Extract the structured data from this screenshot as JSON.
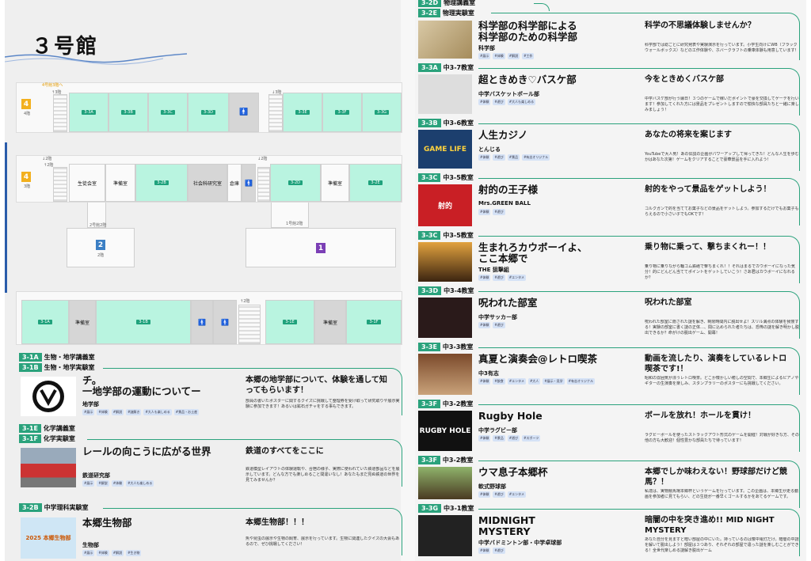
{
  "title": "３号館",
  "floors": {
    "f4_top": {
      "num": "4",
      "num_small": "4階",
      "up_note": "4号館3階へ",
      "up_note2": "↑3階",
      "stair_note": "↓3階",
      "rooms": [
        "3-3A",
        "3-3B",
        "3-3C",
        "3-3D",
        "3-3E",
        "3-3F",
        "3-3G"
      ]
    },
    "f3": {
      "num": "4",
      "num_small": "3階",
      "stair_note": "↓2階",
      "stair_note2": "↓2階",
      "stair_up": "↑2階",
      "rooms": [
        "生徒会室",
        "準備室",
        "3-2B",
        "社会科研究室",
        "倉庫",
        "3-2D",
        "準備室",
        "3-2E"
      ],
      "link_left": "2号館2階",
      "link_right": "1号館2階",
      "num2": "2",
      "num2_small": "2階",
      "num1": "1"
    },
    "f2": {
      "stair_note": "↑2階",
      "rooms": [
        "3-1A",
        "準備室",
        "3-1B",
        "3-1E",
        "準備室",
        "3-1F"
      ]
    }
  },
  "left_entries": [
    {
      "rooms": [
        {
          "code": "3-1A",
          "name": "生物・地学講義室"
        },
        {
          "code": "3-1B",
          "name": "生物・地学実験室"
        }
      ],
      "title": "チ。\n一地学部の運動についてー",
      "club": "地学部",
      "tags": [
        "#展示",
        "#体験",
        "#解説",
        "#謎解き",
        "#大人も楽しめる",
        "#景品・お土産"
      ],
      "headline": "本郷の地学部について、体験を通して知ってもらいます！",
      "desc": "部員の書いたポスターに関するクイズに挑戦して整理券を受け取って研究取りや展示実験に参加できます！あるいは鉱石ガチャをする事もできます。"
    },
    {
      "rooms": [
        {
          "code": "3-1E",
          "name": "化学講義室"
        },
        {
          "code": "3-1F",
          "name": "化学実験室"
        }
      ],
      "title": "レールの向こうに広がる世界",
      "club": "鉄道研究部",
      "tags": [
        "#展示",
        "#解説",
        "#体験",
        "#大人も楽しめる"
      ],
      "headline": "鉄道のすべてをここに",
      "desc": "鉄道模型レイアウトの体験運転や、合宿の様子、実際に使われていた鉄道部品などを展示しています。どんな方でも楽しめること間違いなし！あなたもまだ見ぬ鉄道の世界を見てみませんか？"
    },
    {
      "rooms": [
        {
          "code": "3-2B",
          "name": "中学理科実験室"
        }
      ],
      "title": "本郷生物部",
      "club": "生物部",
      "tags": [
        "#展示",
        "#体験",
        "#解説",
        "#生き物"
      ],
      "headline": "本郷生物部！！！",
      "desc": "魚や昆虫の展示や生物の飼育、展示を行っています。生物に関連したクイズの大会もあるので、ぜひ挑戦してください！",
      "thumb_text": "2025 本郷生物部"
    }
  ],
  "right_top_rooms": [
    {
      "code": "3-2D",
      "name": "物理講義室"
    },
    {
      "code": "3-2E",
      "name": "物理実験室"
    }
  ],
  "right_entries": [
    {
      "room": null,
      "title": "科学部の科学部による\n科学部のための科学部",
      "club": "科学部",
      "tags": [
        "#展示",
        "#体験",
        "#解説",
        "#工作"
      ],
      "headline": "科学の不思議体験しませんか？",
      "desc": "科学部では総ごとに研究発表や実験演示を行っています。小学生向けにWB（ブラックウォールボックス）などの工作体験や、ホバークラフトの乗車体験も用意しています！"
    },
    {
      "room": {
        "code": "3-3A",
        "name": "中3-7教室"
      },
      "title": "超ときめき♡バスケ部",
      "club": "中学バスケットボール部",
      "tags": [
        "#体験",
        "#遊び",
        "#大人も楽しめる"
      ],
      "headline": "今をときめくバスケ部",
      "desc": "中学バスケ部が行う縁日！３つのゲームで稼いだポイントで豪を交換してゲーテを行います！参加してくれた方には景品をプレゼントしますので愉快な部員たちと一緒に楽しみましょう！"
    },
    {
      "room": {
        "code": "3-3B",
        "name": "中3-6教室"
      },
      "title": "人生カジノ",
      "club": "とんじる",
      "tags": [
        "#体験",
        "#遊び",
        "#景品",
        "#有志オリジナル"
      ],
      "headline": "あなたの将来を案じます",
      "desc": "YouTubeで大人気！あの伝説の企画がパワーアップして帰ってきた！どんな人生を歩むかはあなた次第！ゲームをクリアすることで豪華景品を手に入れよう！",
      "thumb_text": "GAME LIFE"
    },
    {
      "room": {
        "code": "3-3C",
        "name": "中3-5教室"
      },
      "title": "射的の王子様",
      "club": "Mrs.GREEN BALL",
      "tags": [
        "#体験",
        "#遊び"
      ],
      "headline": "射的をやって景品をゲットしよう！",
      "desc": "コルクガンで的を当ててお菓子などの景品をゲットしよう。参加するだけでもお菓子もらえるので小さい子でもOKです！",
      "thumb_text": "射的"
    },
    {
      "room": {
        "code": "3-3C",
        "name": "中3-5教室"
      },
      "title": "生まれろカウボーイよ、\nここ本郷で",
      "club": "THE 狙撃組",
      "tags": [
        "#体験",
        "#遊び",
        "#エンタメ"
      ],
      "headline": "乗り物に乗って、撃ちまくれー！！",
      "desc": "乗り物に乗りながら輪ゴム鉄砲で撃ちまくれ！！それはまるでカウボーイになった気分！的にどんどん当ててポイントをゲットしていこう！さあ君はカウボーイになれるか？"
    },
    {
      "room": {
        "code": "3-3D",
        "name": "中3-4教室"
      },
      "title": "呪われた部室",
      "club": "中学サッカー部",
      "tags": [
        "#体験",
        "#遊び"
      ],
      "headline": "呪われた部室",
      "desc": "呪われた部室に隠された謎を解き、制限時間内に脱出せよ！スリル満点の体験を我慢する！実験の部室に書く謎の正体…、間に込められた者たちは、恐怖の謎を解き明かし脱出できるか？命がけの脱出ゲーム、開幕！"
    },
    {
      "room": {
        "code": "3-3E",
        "name": "中3-3教室"
      },
      "title": "真夏と演奏会@レトロ喫茶",
      "club": "中3有志",
      "tags": [
        "#体験",
        "#飲食",
        "#エンタメ",
        "#大人",
        "#展示・見学",
        "#有志オリジナル"
      ],
      "headline": "動画を流したり、演奏をしているレトロ喫茶です!！",
      "desc": "昭和の雰囲気が漂うレトロ喫茶。どこか懐かしい癒しの空間で、本郷生によるピアノやギターの生演奏を楽しみ、スタンプラリーのポスターにも挑戦してください。"
    },
    {
      "room": {
        "code": "3-3F",
        "name": "中3-2教室"
      },
      "title": "Rugby Hole",
      "club": "中学ラグビー部",
      "tags": [
        "#体験",
        "#景品",
        "#遊び",
        "#スポーツ"
      ],
      "headline": "ボールを放れ！ホールを貫け！",
      "desc": "ラグビーボールを使ったストラックアウト形式のゲームを開催！対戦が好きな方、その他の方も大歓迎！個性豊かな部員たちで待っています！",
      "thumb_text": "RUGBY HOLE"
    },
    {
      "room": {
        "code": "3-3F",
        "name": "中3-2教室"
      },
      "title": "ウマ息子本郷杯",
      "club": "軟式野球部",
      "tags": [
        "#体験",
        "#遊び",
        "#エンタメ"
      ],
      "headline": "本郷でしか味わえない！野球部だけど競馬？！",
      "desc": "私達は、実物競馬場本郷杯というゲームを行っています。この企画は、本郷生が走る動画を参加者に見てもらい、どの生徒が一番早くゴールするかをあてるゲームです。"
    },
    {
      "room": {
        "code": "3-3G",
        "name": "中3-1教室"
      },
      "title": "MIDNIGHT\nMYSTERY",
      "club": "中学バドミントン部・中学卓球部",
      "tags": [
        "#体験",
        "#遊び"
      ],
      "headline": "暗闇の中を突き進め!! MID NIGHT MYSTERY",
      "desc": "あなた自分を見ますと暗い部屋の中にいた。持っているのは懐中電灯だけ。暗闇の中謎を解いて脱出しよう！部屋は３つあり、それぞれの部屋で違った謎を楽しむことができる！全世代楽しめる謎解き脱出ゲーム"
    }
  ],
  "colors": {
    "accent": "#2aa27c",
    "classroom": "#b9f4e0",
    "badge4": "#f2b01e",
    "badge2": "#3b7fc4",
    "badge1": "#7b3fb5"
  }
}
